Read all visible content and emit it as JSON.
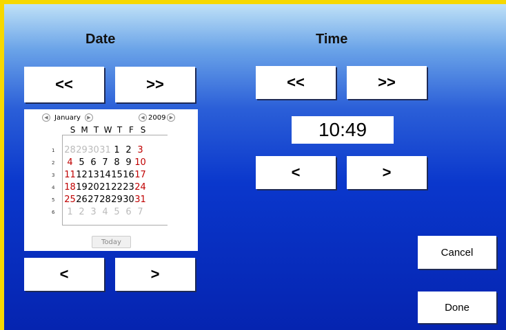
{
  "date": {
    "heading": "Date",
    "prev_month_label": "<<",
    "next_month_label": ">>",
    "prev_day_label": "<",
    "next_day_label": ">"
  },
  "time": {
    "heading": "Time",
    "prev_big_label": "<<",
    "next_big_label": ">>",
    "display": "10:49",
    "prev_label": "<",
    "next_label": ">"
  },
  "calendar": {
    "month": "January",
    "year": "2009",
    "today_label": "Today",
    "weekdays": [
      "S",
      "M",
      "T",
      "W",
      "T",
      "F",
      "S"
    ],
    "week_numbers": [
      "1",
      "2",
      "3",
      "4",
      "5",
      "6"
    ],
    "weeks": [
      [
        "28",
        "29",
        "30",
        "31",
        "1",
        "2",
        "3"
      ],
      [
        "4",
        "5",
        "6",
        "7",
        "8",
        "9",
        "10"
      ],
      [
        "11",
        "12",
        "13",
        "14",
        "15",
        "16",
        "17"
      ],
      [
        "18",
        "19",
        "20",
        "21",
        "22",
        "23",
        "24"
      ],
      [
        "25",
        "26",
        "27",
        "28",
        "29",
        "30",
        "31"
      ],
      [
        "1",
        "2",
        "3",
        "4",
        "5",
        "6",
        "7"
      ]
    ]
  },
  "actions": {
    "cancel_label": "Cancel",
    "done_label": "Done"
  },
  "colors": {
    "frame": "#f6d800",
    "weekend": "#c00000",
    "other_month": "#bbbbbb"
  }
}
